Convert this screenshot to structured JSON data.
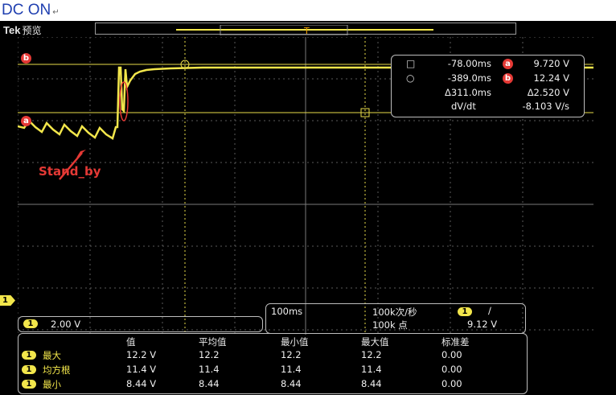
{
  "doc_title": "DC ON",
  "doc_title_mark": "↵",
  "scope": {
    "brand": "Tek",
    "mode": "预览",
    "annotation": "Stand_by",
    "cursor_a_label": "a",
    "cursor_b_label": "b",
    "channel_marker": "1",
    "measurement": {
      "rows": [
        {
          "symbol": "□",
          "time": "-78.00ms",
          "cursor": "a",
          "value": "9.720 V"
        },
        {
          "symbol": "○",
          "time": "-389.0ms",
          "cursor": "b",
          "value": "12.24 V"
        },
        {
          "symbol": "",
          "time": "Δ311.0ms",
          "cursor": "",
          "value": "Δ2.520 V"
        }
      ],
      "slope_label": "dV/dt",
      "slope_value": "-8.103 V/s"
    },
    "vertical": {
      "channel": "1",
      "scale": "2.00 V"
    },
    "horizontal": {
      "time_div": "100ms",
      "sample_rate": "100k次/秒",
      "record_length": "100k 点",
      "trigger_channel": "1",
      "trigger_slope": "∕",
      "trigger_level": "9.12 V"
    },
    "stats": {
      "headers": [
        "值",
        "平均值",
        "最小值",
        "最大值",
        "标准差"
      ],
      "rows": [
        {
          "channel": "1",
          "name": "最大",
          "values": [
            "12.2 V",
            "12.2",
            "12.2",
            "12.2",
            "0.00"
          ]
        },
        {
          "channel": "1",
          "name": "均方根",
          "values": [
            "11.4 V",
            "11.4",
            "11.4",
            "11.4",
            "0.00"
          ]
        },
        {
          "channel": "1",
          "name": "最小",
          "values": [
            "8.44 V",
            "8.44",
            "8.44",
            "8.44",
            "0.00"
          ]
        }
      ]
    },
    "colors": {
      "trace": "#f2e64b",
      "cursor": "#e53935",
      "grid": "#5a5a5a"
    }
  }
}
